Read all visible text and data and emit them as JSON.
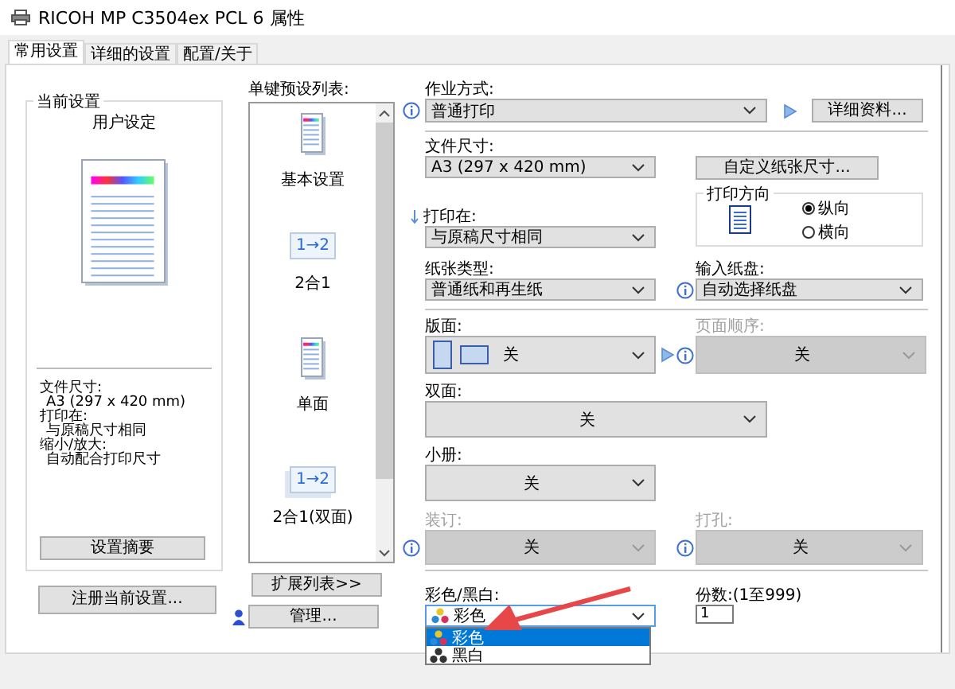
{
  "window": {
    "title": "RICOH MP C3504ex PCL 6 属性"
  },
  "tabs": [
    {
      "label": "常用设置",
      "selected": true
    },
    {
      "label": "详细的设置",
      "selected": false
    },
    {
      "label": "配置/关于",
      "selected": false
    }
  ],
  "current_settings": {
    "title": "当前设置",
    "profile": "用户设定",
    "summary": [
      {
        "text": "文件尺寸:",
        "kind": "label"
      },
      {
        "text": "A3 (297 x 420 mm)",
        "kind": "value"
      },
      {
        "text": "打印在:",
        "kind": "label"
      },
      {
        "text": "与原稿尺寸相同",
        "kind": "value"
      },
      {
        "text": "缩小/放大:",
        "kind": "label"
      },
      {
        "text": "自动配合打印尺寸",
        "kind": "value"
      }
    ],
    "summary_button": "设置摘要",
    "register_button": "注册当前设置..."
  },
  "presets": {
    "title": "单键预设列表:",
    "items": [
      {
        "label": "基本设置",
        "kind": "page"
      },
      {
        "label": "2合1",
        "kind": "combine",
        "icon_text": "1→2"
      },
      {
        "label": "单面",
        "kind": "page"
      },
      {
        "label": "2合1(双面)",
        "kind": "combine_duplex",
        "icon_text": "1→2"
      }
    ],
    "expand_button": "扩展列表>>",
    "manage_button": "管理..."
  },
  "job_type": {
    "label": "作业方式:",
    "value": "普通打印",
    "details_button": "详细资料..."
  },
  "paper_size": {
    "label": "文件尺寸:",
    "value": "A3 (297 x 420 mm)"
  },
  "custom_size_button": "自定义纸张尺寸...",
  "print_on": {
    "label": "打印在:",
    "value": "与原稿尺寸相同"
  },
  "orientation": {
    "title": "打印方向",
    "options": [
      {
        "label": "纵向",
        "selected": true
      },
      {
        "label": "横向",
        "selected": false
      }
    ]
  },
  "paper_type": {
    "label": "纸张类型:",
    "value": "普通纸和再生纸"
  },
  "input_tray": {
    "label": "输入纸盘:",
    "value": "自动选择纸盘"
  },
  "layout": {
    "label": "版面:",
    "value": "关"
  },
  "page_order": {
    "label": "页面顺序:",
    "value": "关",
    "disabled": true
  },
  "duplex": {
    "label": "双面:",
    "value": "关",
    "disabled": false
  },
  "booklet": {
    "label": "小册:",
    "value": "关",
    "disabled": false
  },
  "staple": {
    "label": "装订:",
    "value": "关",
    "disabled": true
  },
  "punch": {
    "label": "打孔:",
    "value": "关",
    "disabled": true
  },
  "color_mode": {
    "label": "彩色/黑白:",
    "value": "彩色",
    "kind": "color",
    "expanded": true,
    "options": [
      {
        "label": "彩色",
        "kind": "color",
        "selected": true
      },
      {
        "label": "黑白",
        "kind": "mono",
        "selected": false
      }
    ]
  },
  "copies": {
    "label": "份数:(1至999)",
    "value": "1"
  }
}
